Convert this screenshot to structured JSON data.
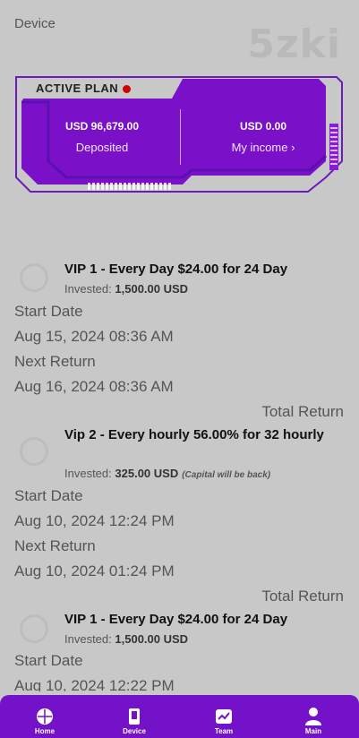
{
  "header": {
    "device_label": "Device",
    "brand": "5zki"
  },
  "plan_card": {
    "title": "ACTIVE PLAN",
    "deposited_amount": "USD 96,679.00",
    "deposited_label": "Deposited",
    "income_amount": "USD 0.00",
    "income_label": "My income",
    "colors": {
      "primary": "#7a10c8",
      "accent": "#5b0fb0"
    }
  },
  "plans": [
    {
      "title": "VIP 1 - Every Day $24.00 for 24 Day",
      "invested_label": "Invested:",
      "invested_value": "1,500.00 USD",
      "note": "",
      "start_label": "Start Date",
      "start_value": "Aug 15, 2024 08:36 AM",
      "next_label": "Next Return",
      "next_value": "Aug 16, 2024 08:36 AM",
      "total_label": "Total Return"
    },
    {
      "title": "Vip 2 - Every hourly 56.00% for 32 hourly",
      "invested_label": "Invested:",
      "invested_value": "325.00 USD",
      "note": "(Capital will be back)",
      "start_label": "Start Date",
      "start_value": "Aug 10, 2024 12:24 PM",
      "next_label": "Next Return",
      "next_value": "Aug 10, 2024 01:24 PM",
      "total_label": "Total Return"
    },
    {
      "title": "VIP 1 - Every Day $24.00 for 24 Day",
      "invested_label": "Invested:",
      "invested_value": "1,500.00 USD",
      "start_label": "Start Date",
      "start_value": "Aug 10, 2024 12:22 PM"
    }
  ],
  "nav": {
    "items": [
      {
        "label": "Home",
        "icon": "home-icon"
      },
      {
        "label": "Device",
        "icon": "device-icon"
      },
      {
        "label": "Team",
        "icon": "team-icon"
      },
      {
        "label": "Main",
        "icon": "user-icon"
      }
    ],
    "color": "#7312c9"
  }
}
